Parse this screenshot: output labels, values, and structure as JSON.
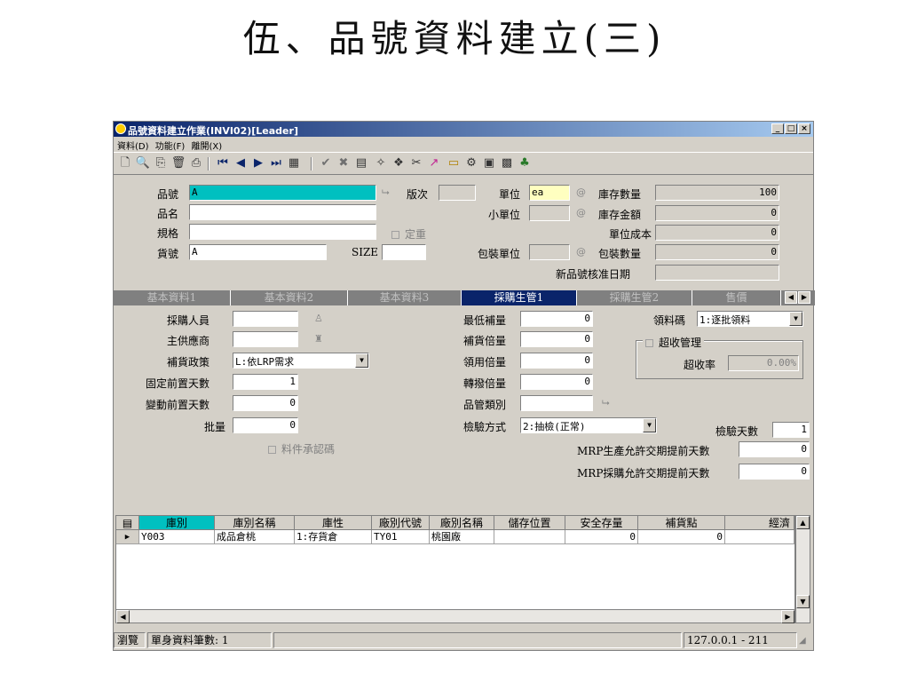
{
  "slide": {
    "title": "伍、品號資料建立(三)"
  },
  "window": {
    "title": "品號資料建立作業(INVI02)[Leader]"
  },
  "menu": [
    "資料(D)",
    "功能(F)",
    "離開(X)"
  ],
  "header": {
    "item_no_label": "品號",
    "item_no": "A",
    "item_name_label": "品名",
    "item_name": "",
    "spec_label": "規格",
    "spec": "",
    "cargo_no_label": "貨號",
    "cargo_no": "A",
    "version_label": "版次",
    "version": "",
    "fixed_weight_label": "定重",
    "size_label": "SIZE",
    "size": "",
    "unit_label": "單位",
    "unit": "ea",
    "small_unit_label": "小單位",
    "small_unit": "",
    "pack_unit_label": "包裝單位",
    "pack_unit": "",
    "stock_qty_label": "庫存數量",
    "stock_qty": "100",
    "stock_amt_label": "庫存金額",
    "stock_amt": "0",
    "unit_cost_label": "單位成本",
    "unit_cost": "0",
    "pack_qty_label": "包裝數量",
    "pack_qty": "0",
    "approve_date_label": "新品號核准日期",
    "approve_date": ""
  },
  "tabs": [
    {
      "label": "基本資料1"
    },
    {
      "label": "基本資料2"
    },
    {
      "label": "基本資料3"
    },
    {
      "label": "採購生管1"
    },
    {
      "label": "採購生管2"
    },
    {
      "label": "售價"
    }
  ],
  "active_tab": 3,
  "form": {
    "buyer_label": "採購人員",
    "buyer": "",
    "main_supplier_label": "主供應商",
    "main_supplier": "",
    "replenish_policy_label": "補貨政策",
    "replenish_policy": "L:依LRP需求",
    "fixed_lead_label": "固定前置天數",
    "fixed_lead": "1",
    "var_lead_label": "變動前置天數",
    "var_lead": "0",
    "batch_label": "批量",
    "batch": "0",
    "material_cert_label": "料件承認碼",
    "min_replenish_label": "最低補量",
    "min_replenish": "0",
    "replenish_multiple_label": "補貨倍量",
    "replenish_multiple": "0",
    "issue_multiple_label": "領用倍量",
    "issue_multiple": "0",
    "transfer_multiple_label": "轉撥倍量",
    "transfer_multiple": "0",
    "qc_category_label": "品管類別",
    "qc_category": "",
    "inspection_method_label": "檢驗方式",
    "inspection_method": "2:抽檢(正常)",
    "issue_code_label": "領料碼",
    "issue_code": "1:逐批領料",
    "over_receive_label": "超收管理",
    "over_receive_rate_label": "超收率",
    "over_receive_rate": "0.00%",
    "inspection_days_label": "檢驗天數",
    "inspection_days": "1",
    "mrp_prod_label": "MRP生產允許交期提前天數",
    "mrp_prod_days": "0",
    "mrp_purch_label": "MRP採購允許交期提前天數",
    "mrp_purch_days": "0"
  },
  "grid": {
    "columns": [
      "庫別",
      "庫別名稱",
      "庫性",
      "廠別代號",
      "廠別名稱",
      "儲存位置",
      "安全存量",
      "補貨點",
      "經濟"
    ],
    "rows": [
      [
        "Y003",
        "成品倉桃",
        "1:存貨倉",
        "TY01",
        "桃園廠",
        "",
        "0",
        "0",
        ""
      ]
    ]
  },
  "status": {
    "mode": "瀏覽",
    "record_count": "單身資料筆數: 1",
    "host": "127.0.0.1 - 211"
  }
}
